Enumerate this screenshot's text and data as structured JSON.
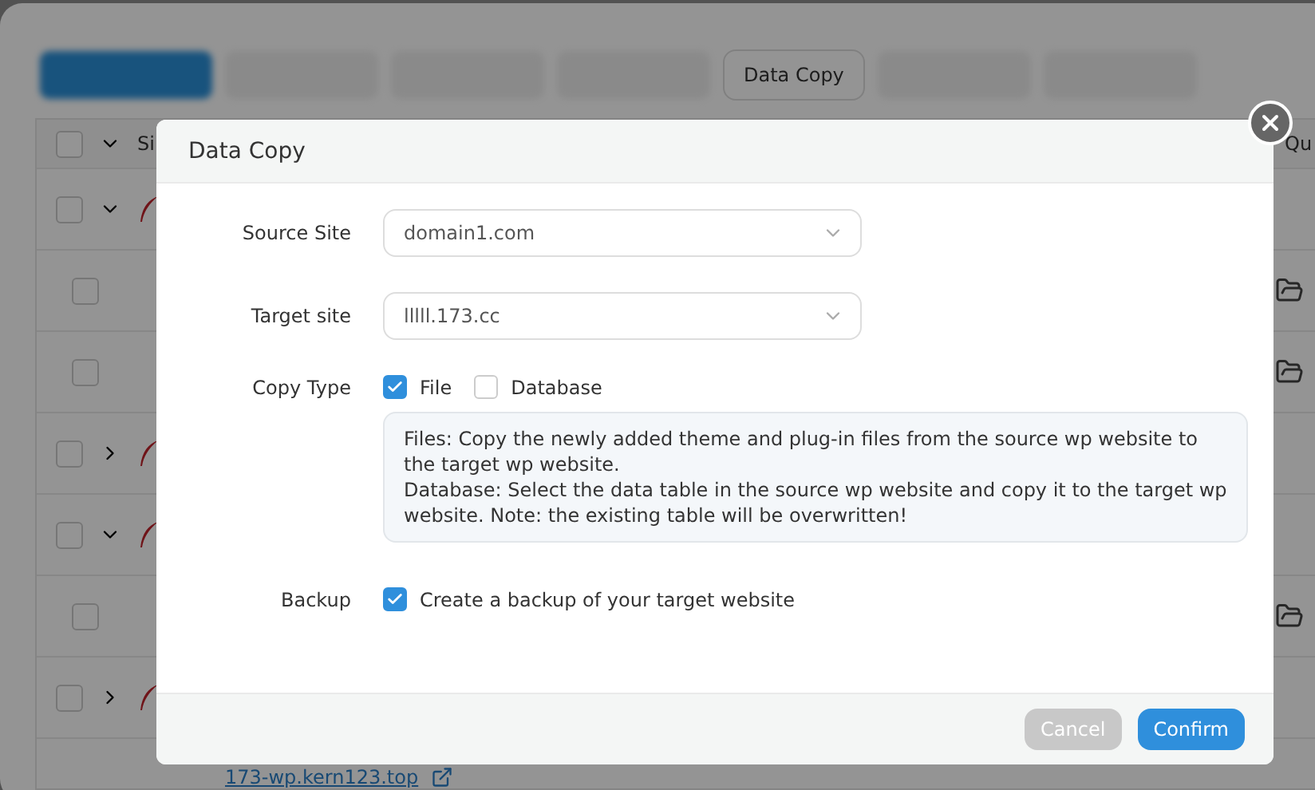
{
  "toolbar": {
    "buttons": [
      {
        "kind": "blurred_primary"
      },
      {
        "kind": "blurred"
      },
      {
        "kind": "blurred"
      },
      {
        "kind": "blurred"
      },
      {
        "kind": "text",
        "label": "Data Copy"
      },
      {
        "kind": "blurred"
      },
      {
        "kind": "blurred"
      }
    ]
  },
  "table": {
    "columns": [
      "Si",
      "Qu"
    ],
    "all_checked": false,
    "rows": [
      {
        "kind": "site",
        "expanded": true,
        "checked": false
      },
      {
        "kind": "child",
        "checked": false
      },
      {
        "kind": "child",
        "checked": false
      },
      {
        "kind": "site",
        "expanded": false,
        "checked": false
      },
      {
        "kind": "site",
        "expanded": true,
        "checked": false
      },
      {
        "kind": "child",
        "checked": false
      },
      {
        "kind": "site",
        "expanded": false,
        "checked": false
      }
    ],
    "link": "173-wp.kern123.top"
  },
  "dialog": {
    "title": "Data Copy",
    "source_site": {
      "label": "Source Site",
      "value": "domain1.com"
    },
    "target_site": {
      "label": "Target site",
      "value": "lllll.173.cc"
    },
    "copy_type": {
      "label": "Copy Type",
      "options": [
        {
          "label": "File",
          "checked": true
        },
        {
          "label": "Database",
          "checked": false
        }
      ],
      "description": [
        "Files: Copy the newly added theme and plug-in files from the source wp website to the target wp website.",
        "Database: Select the data table in the source wp website and copy it to the target wp website. Note: the existing table will be overwritten!"
      ]
    },
    "backup": {
      "label": "Backup",
      "checked": true,
      "text": "Create a backup of your target website"
    },
    "buttons": [
      {
        "label": "Cancel",
        "disabled": true
      },
      {
        "label": "Confirm",
        "disabled": false
      }
    ]
  }
}
